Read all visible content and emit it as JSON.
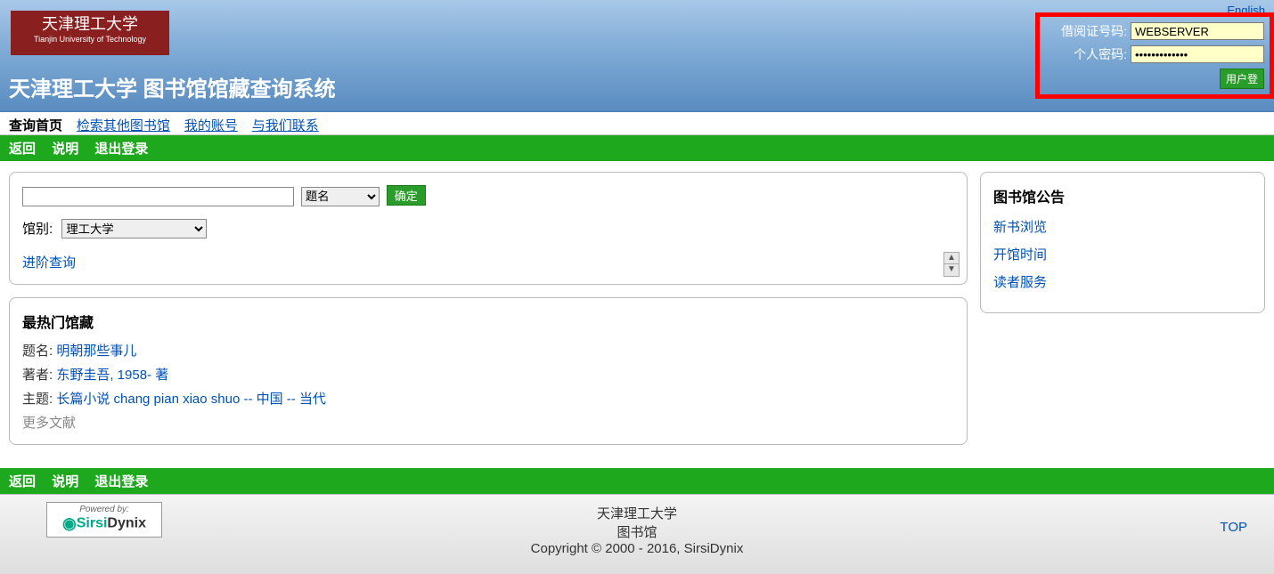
{
  "lang_link": "English",
  "logo": {
    "main": "天津理工大学",
    "sub": "Tianjin University of Technology"
  },
  "site_title": "天津理工大学 图书馆馆藏查询系统",
  "login": {
    "id_label": "借阅证号码:",
    "id_value": "WEBSERVER",
    "pw_label": "个人密码:",
    "pw_value": "•••••••••••••",
    "button": "用户登"
  },
  "tabs": {
    "home": "查询首页",
    "other": "检索其他图书馆",
    "account": "我的账号",
    "contact": "与我们联系"
  },
  "greenbar": {
    "back": "返回",
    "help": "说明",
    "logout": "退出登录"
  },
  "search": {
    "field_option": "题名",
    "confirm": "确定",
    "guanbie_label": "馆别:",
    "guanbie_option": "理工大学",
    "advanced": "进阶查询"
  },
  "hot": {
    "title": "最热门馆藏",
    "rows": [
      {
        "label": "题名:",
        "link": "明朝那些事儿"
      },
      {
        "label": "著者:",
        "link": "东野圭吾, 1958- 著"
      },
      {
        "label": "主题:",
        "link": "长篇小说 chang pian xiao shuo -- 中国 -- 当代"
      }
    ],
    "more": "更多文献"
  },
  "notice": {
    "title": "图书馆公告",
    "links": [
      "新书浏览",
      "开馆时间",
      "读者服务"
    ]
  },
  "footer": {
    "powered_label": "Powered by:",
    "uni": "天津理工大学",
    "lib": "图书馆",
    "copyright": "Copyright © 2000 - 2016, SirsiDynix",
    "top": "TOP"
  }
}
